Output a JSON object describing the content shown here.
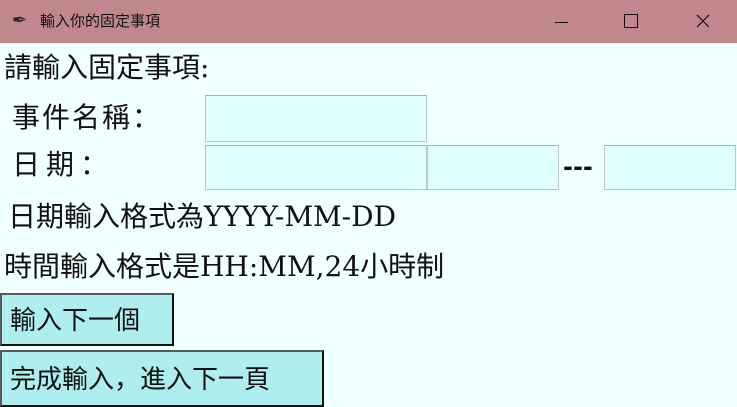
{
  "window": {
    "title": "輸入你的固定事項",
    "app_icon": "feather-icon",
    "controls": [
      "minimize-icon",
      "maximize-icon",
      "close-icon"
    ]
  },
  "form": {
    "heading": "請輸入固定事項:",
    "event_name_label": "事件名稱：",
    "event_name_value": "",
    "date_label": "日期：",
    "date_field_1_value": "",
    "date_field_2_value": "",
    "date_field_3_value": "",
    "date_separator": "---",
    "date_format_hint": "日期輸入格式為YYYY-MM-DD",
    "time_format_hint": "時間輸入格式是HH:MM,24小時制"
  },
  "buttons": {
    "next_entry": "輸入下一個",
    "finish": "完成輸入，進入下一頁"
  },
  "colors": {
    "titlebar": "#c0888c",
    "background": "#f0ffff",
    "field": "#e0ffff",
    "button": "#aeeeee"
  }
}
